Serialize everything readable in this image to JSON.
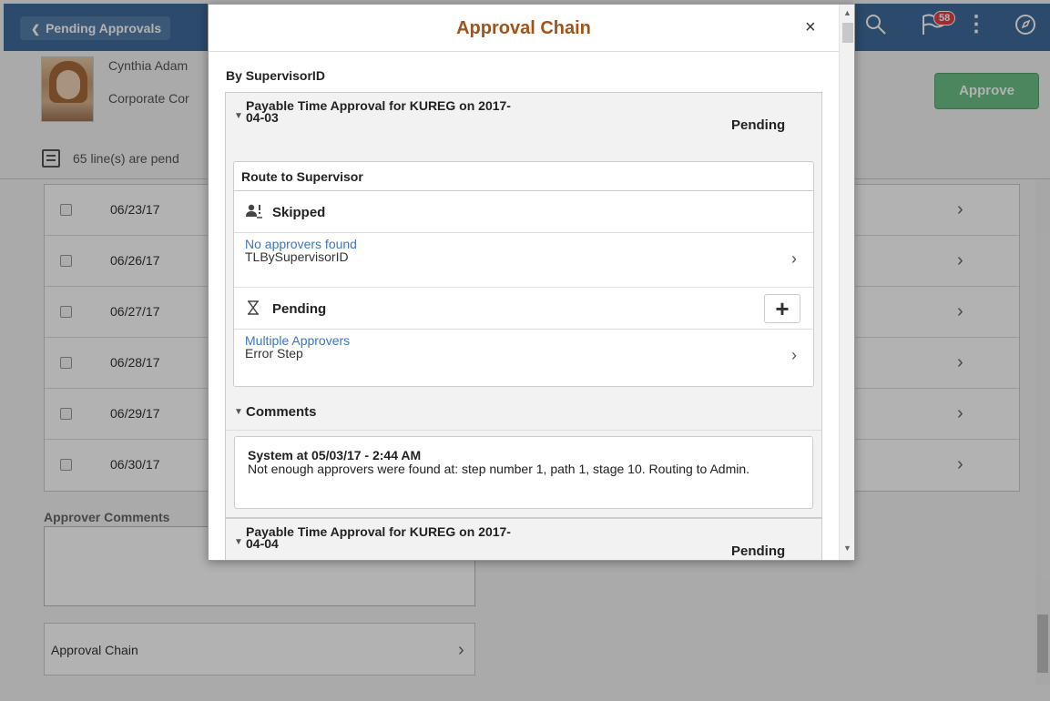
{
  "header": {
    "back_label": "Pending Approvals",
    "notification_count": "58"
  },
  "profile": {
    "name": "Cynthia Adam",
    "department": "Corporate Cor"
  },
  "actions": {
    "approve_label": "Approve"
  },
  "pending_summary": "65 line(s) are pend",
  "rows": [
    {
      "date": "06/23/17"
    },
    {
      "date": "06/26/17"
    },
    {
      "date": "06/27/17"
    },
    {
      "date": "06/28/17"
    },
    {
      "date": "06/29/17"
    },
    {
      "date": "06/30/17"
    }
  ],
  "approver_comments_label": "Approver Comments",
  "approval_chain_label": "Approval Chain",
  "modal": {
    "title": "Approval Chain",
    "close_label": "×",
    "group_label": "By SupervisorID",
    "sections": [
      {
        "title_line1": "Payable Time Approval for KUREG on 2017-",
        "title_line2": "04-03",
        "status": "Pending"
      },
      {
        "title_line1": "Payable Time Approval for KUREG on 2017-",
        "title_line2": "04-04",
        "status": "Pending"
      }
    ],
    "route": {
      "title": "Route to Supervisor",
      "steps": [
        {
          "label": "Skipped",
          "icon": "user-skip-icon",
          "approver_link": "No approvers found",
          "approver_sub": "TLBySupervisorID"
        },
        {
          "label": "Pending",
          "icon": "hourglass-icon",
          "approver_link": "Multiple Approvers",
          "approver_sub": "Error Step"
        }
      ]
    },
    "comments": {
      "title": "Comments",
      "meta": "System at 05/03/17 - 2:44 AM",
      "text": "Not enough approvers were found at: step number 1, path 1, stage 10. Routing to Admin."
    }
  },
  "colors": {
    "topbar": "#3f6b9a",
    "modal_title": "#a0541a",
    "approve": "#6cc087",
    "link": "#4174bd",
    "badge": "#e0424a"
  }
}
